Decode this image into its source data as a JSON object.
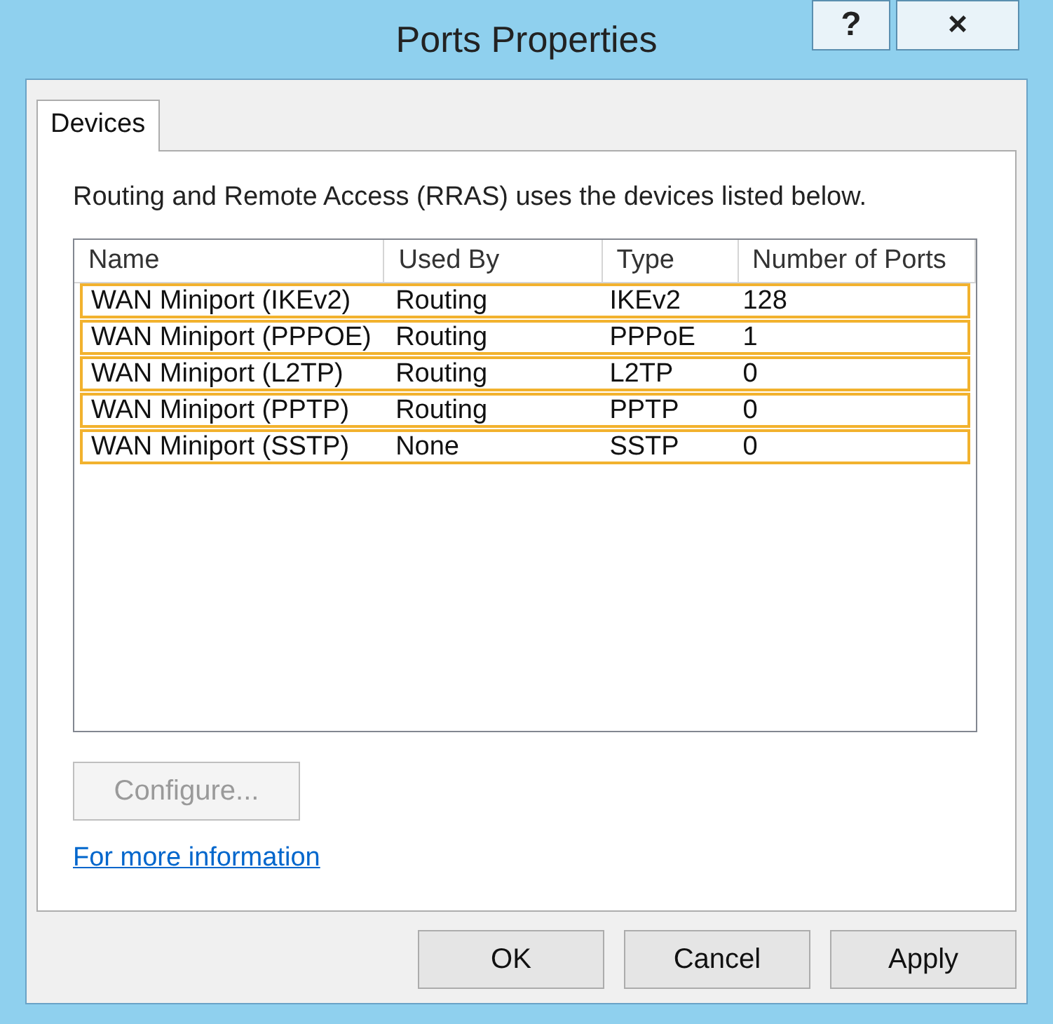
{
  "window": {
    "title": "Ports Properties",
    "help_button": "?",
    "close_button": "×"
  },
  "tabs": [
    {
      "label": "Devices",
      "selected": true
    }
  ],
  "description": "Routing and Remote Access (RRAS) uses the devices listed below.",
  "table": {
    "columns": [
      "Name",
      "Used By",
      "Type",
      "Number of Ports"
    ],
    "rows": [
      {
        "cells": [
          "WAN Miniport (IKEv2)",
          "Routing",
          "IKEv2",
          "128"
        ],
        "highlighted": true
      },
      {
        "cells": [
          "WAN Miniport (PPPOE)",
          "Routing",
          "PPPoE",
          "1"
        ],
        "highlighted": true
      },
      {
        "cells": [
          "WAN Miniport (L2TP)",
          "Routing",
          "L2TP",
          "0"
        ],
        "highlighted": true
      },
      {
        "cells": [
          "WAN Miniport (PPTP)",
          "Routing",
          "PPTP",
          "0"
        ],
        "highlighted": true
      },
      {
        "cells": [
          "WAN Miniport (SSTP)",
          "None",
          "SSTP",
          "0"
        ],
        "highlighted": true
      }
    ]
  },
  "configure_button": {
    "label": "Configure...",
    "disabled": true
  },
  "link": "For more information",
  "buttons": [
    "OK",
    "Cancel",
    "Apply"
  ]
}
